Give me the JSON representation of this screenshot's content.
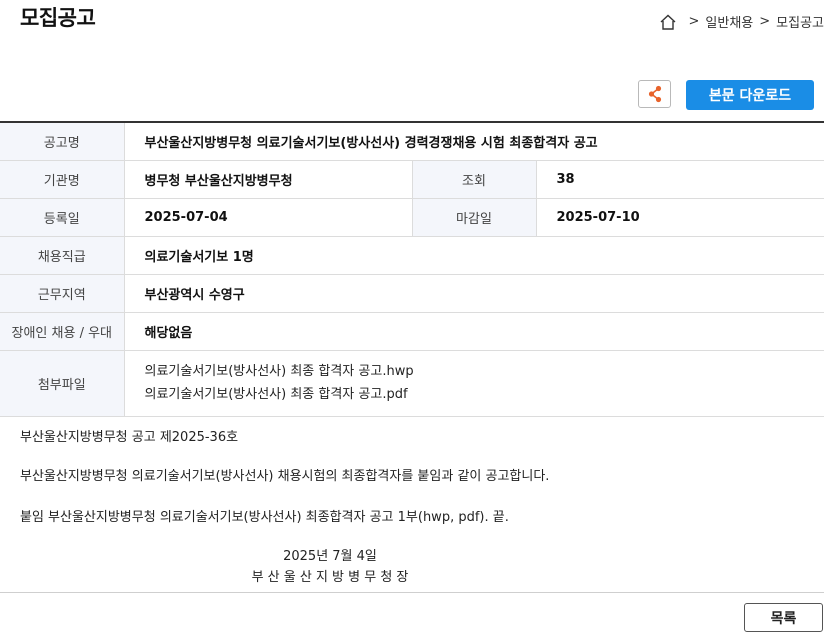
{
  "header": {
    "title": "모집공고",
    "breadcrumb": {
      "sep1": ">",
      "item1": "일반채용",
      "sep2": ">",
      "item2": "모집공고"
    }
  },
  "toolbar": {
    "download_label": "본문 다운로드",
    "share_icon": "share-icon"
  },
  "notice": {
    "labels": {
      "title": "공고명",
      "agency": "기관명",
      "views": "조회",
      "registered": "등록일",
      "deadline": "마감일",
      "position": "채용직급",
      "location": "근무지역",
      "disability": "장애인 채용 / 우대",
      "attachments": "첨부파일"
    },
    "title": "부산울산지방병무청 의료기술서기보(방사선사) 경력경쟁채용 시험 최종합격자 공고",
    "agency": "병무청 부산울산지방병무청",
    "views": "38",
    "registered": "2025-07-04",
    "deadline": "2025-07-10",
    "position": "의료기술서기보 1명",
    "location": "부산광역시 수영구",
    "disability": "해당없음",
    "attachments": [
      "의료기술서기보(방사선사) 최종 합격자 공고.hwp",
      "의료기술서기보(방사선사) 최종 합격자 공고.pdf"
    ]
  },
  "body": {
    "line1": "부산울산지방병무청 공고 제2025-36호",
    "line2": "부산울산지방병무청 의료기술서기보(방사선사) 채용시험의 최종합격자를 붙임과 같이 공고합니다.",
    "line3": "붙임  부산울산지방병무청 의료기술서기보(방사선사) 최종합격자 공고 1부(hwp, pdf).  끝.",
    "date": "2025년 7월 4일",
    "signer": "부 산 울 산 지 방 병 무 청 장"
  },
  "footer": {
    "list_label": "목록"
  },
  "colors": {
    "accent": "#1a8de6",
    "share": "#e8632b",
    "header_cell": "#f4f6fb"
  }
}
